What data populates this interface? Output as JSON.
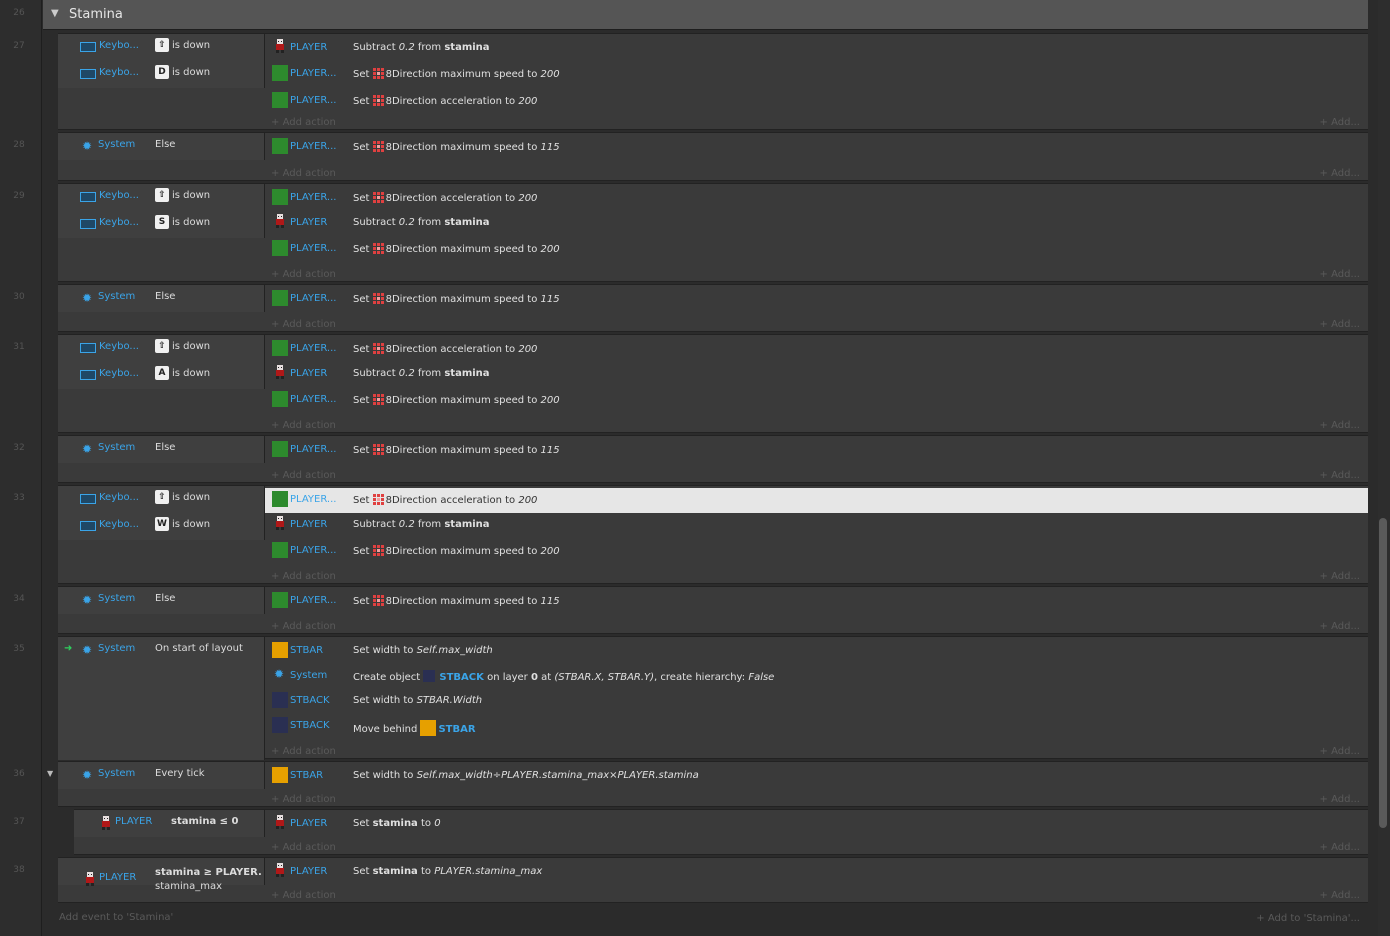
{
  "group": {
    "name": "Stamina",
    "line": "26"
  },
  "labels": {
    "add_action": "Add action",
    "add": "Add...",
    "add_event": "Add event to 'Stamina'",
    "add_to": "Add to 'Stamina'..."
  },
  "colors": {
    "object_blue": "#3aa4e8",
    "player_green": "#2d8a2d",
    "stbar_orange": "#e6a000",
    "stback_navy": "#2a2f52",
    "highlight": "#e6e6e6",
    "trigger_green": "#2fd05e"
  },
  "events": [
    {
      "line": "27",
      "conditions": [
        {
          "icon": "keyboard-icon",
          "object": "Keybo...",
          "key": "⇧",
          "text": "is down"
        },
        {
          "icon": "keyboard-icon",
          "object": "Keybo...",
          "key": "D",
          "text": "is down"
        }
      ],
      "actions": [
        {
          "icon": "player-sprite-icon",
          "object": "PLAYER",
          "text": "Subtract 0.2 from stamina"
        },
        {
          "icon": "green-square-icon",
          "object": "PLAYER...",
          "text": "Set 8Direction maximum speed to 200"
        },
        {
          "icon": "green-square-icon",
          "object": "PLAYER...",
          "text": "Set 8Direction acceleration to 200"
        }
      ]
    },
    {
      "line": "28",
      "conditions": [
        {
          "icon": "gear-icon",
          "object": "System",
          "text": "Else"
        }
      ],
      "actions": [
        {
          "icon": "green-square-icon",
          "object": "PLAYER...",
          "text": "Set 8Direction maximum speed to 115"
        }
      ]
    },
    {
      "line": "29",
      "conditions": [
        {
          "icon": "keyboard-icon",
          "object": "Keybo...",
          "key": "⇧",
          "text": "is down"
        },
        {
          "icon": "keyboard-icon",
          "object": "Keybo...",
          "key": "S",
          "text": "is down"
        }
      ],
      "actions": [
        {
          "icon": "green-square-icon",
          "object": "PLAYER...",
          "text": "Set 8Direction acceleration to 200"
        },
        {
          "icon": "player-sprite-icon",
          "object": "PLAYER",
          "text": "Subtract 0.2 from stamina"
        },
        {
          "icon": "green-square-icon",
          "object": "PLAYER...",
          "text": "Set 8Direction maximum speed to 200"
        }
      ]
    },
    {
      "line": "30",
      "conditions": [
        {
          "icon": "gear-icon",
          "object": "System",
          "text": "Else"
        }
      ],
      "actions": [
        {
          "icon": "green-square-icon",
          "object": "PLAYER...",
          "text": "Set 8Direction maximum speed to 115"
        }
      ]
    },
    {
      "line": "31",
      "conditions": [
        {
          "icon": "keyboard-icon",
          "object": "Keybo...",
          "key": "⇧",
          "text": "is down"
        },
        {
          "icon": "keyboard-icon",
          "object": "Keybo...",
          "key": "A",
          "text": "is down"
        }
      ],
      "actions": [
        {
          "icon": "green-square-icon",
          "object": "PLAYER...",
          "text": "Set 8Direction acceleration to 200"
        },
        {
          "icon": "player-sprite-icon",
          "object": "PLAYER",
          "text": "Subtract 0.2 from stamina"
        },
        {
          "icon": "green-square-icon",
          "object": "PLAYER...",
          "text": "Set 8Direction maximum speed to 200"
        }
      ]
    },
    {
      "line": "32",
      "conditions": [
        {
          "icon": "gear-icon",
          "object": "System",
          "text": "Else"
        }
      ],
      "actions": [
        {
          "icon": "green-square-icon",
          "object": "PLAYER...",
          "text": "Set 8Direction maximum speed to 115"
        }
      ]
    },
    {
      "line": "33",
      "conditions": [
        {
          "icon": "keyboard-icon",
          "object": "Keybo...",
          "key": "⇧",
          "text": "is down"
        },
        {
          "icon": "keyboard-icon",
          "object": "Keybo...",
          "key": "W",
          "text": "is down"
        }
      ],
      "actions": [
        {
          "icon": "green-square-icon",
          "object": "PLAYER...",
          "text": "Set 8Direction acceleration to 200",
          "selected": true
        },
        {
          "icon": "player-sprite-icon",
          "object": "PLAYER",
          "text": "Subtract 0.2 from stamina"
        },
        {
          "icon": "green-square-icon",
          "object": "PLAYER...",
          "text": "Set 8Direction maximum speed to 200"
        }
      ]
    },
    {
      "line": "34",
      "conditions": [
        {
          "icon": "gear-icon",
          "object": "System",
          "text": "Else"
        }
      ],
      "actions": [
        {
          "icon": "green-square-icon",
          "object": "PLAYER...",
          "text": "Set 8Direction maximum speed to 115"
        }
      ]
    },
    {
      "line": "35",
      "conditions": [
        {
          "icon": "gear-icon",
          "object": "System",
          "text": "On start of layout",
          "trigger": true
        }
      ],
      "actions": [
        {
          "icon": "orange-square-icon",
          "object": "STBAR",
          "text": "Set width to Self.max_width"
        },
        {
          "icon": "gear-icon",
          "object": "System",
          "text": "Create object STBACK on layer 0 at (STBAR.X, STBAR.Y), create hierarchy: False"
        },
        {
          "icon": "navy-square-icon",
          "object": "STBACK",
          "text": "Set width to STBAR.Width"
        },
        {
          "icon": "navy-square-icon",
          "object": "STBACK",
          "text": "Move behind STBAR"
        }
      ]
    },
    {
      "line": "36",
      "conditions": [
        {
          "icon": "gear-icon",
          "object": "System",
          "text": "Every tick"
        }
      ],
      "actions": [
        {
          "icon": "orange-square-icon",
          "object": "STBAR",
          "text": "Set width to Self.max_width÷PLAYER.stamina_max×PLAYER.stamina"
        }
      ]
    },
    {
      "line": "37",
      "conditions": [
        {
          "icon": "player-sprite-icon",
          "object": "PLAYER",
          "text": "stamina ≤ 0"
        }
      ],
      "actions": [
        {
          "icon": "player-sprite-icon",
          "object": "PLAYER",
          "text": "Set stamina to 0"
        }
      ]
    },
    {
      "line": "38",
      "conditions": [
        {
          "icon": "player-sprite-icon",
          "object": "PLAYER",
          "text": "stamina ≥ PLAYER.",
          "text2": "stamina_max"
        }
      ],
      "actions": [
        {
          "icon": "player-sprite-icon",
          "object": "PLAYER",
          "text": "Set stamina to PLAYER.stamina_max"
        }
      ]
    }
  ]
}
